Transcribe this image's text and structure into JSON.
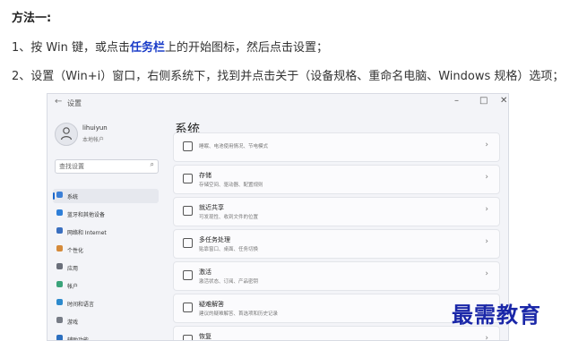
{
  "article": {
    "heading": "方法一:",
    "step1_pre": "1、按 Win 键，或点击",
    "step1_keyword": "任务栏",
    "step1_post": "上的开始图标，然后点击设置；",
    "step2": "2、设置（Win+i）窗口，右侧系统下，找到并点击关于（设备规格、重命名电脑、Windows 规格）选项；"
  },
  "window": {
    "back_glyph": "←",
    "title": "设置",
    "controls": {
      "minimize": "–",
      "maximize": "□",
      "close": "✕"
    },
    "user": {
      "name": "lihuiyun",
      "type": "本地帐户"
    },
    "search": {
      "placeholder": "查找设置",
      "icon": "search-icon"
    },
    "nav": [
      {
        "label": "系统",
        "color": "#3b7fd6",
        "active": true
      },
      {
        "label": "蓝牙和其他设备",
        "color": "#2f7fd8"
      },
      {
        "label": "网络和 Internet",
        "color": "#3a6fbf"
      },
      {
        "label": "个性化",
        "color": "#d58a3a"
      },
      {
        "label": "应用",
        "color": "#6a6f7a"
      },
      {
        "label": "帐户",
        "color": "#3aa37a"
      },
      {
        "label": "时间和语言",
        "color": "#2d8acd"
      },
      {
        "label": "游戏",
        "color": "#777c86"
      },
      {
        "label": "辅助功能",
        "color": "#2c6fbf"
      }
    ],
    "content": {
      "title": "系统",
      "cards": [
        {
          "title": "",
          "subtitle": "睡眠、电池使用情况、节电模式",
          "icon": "power-icon"
        },
        {
          "title": "存储",
          "subtitle": "存储空间、驱动器、配置规则",
          "icon": "storage-icon"
        },
        {
          "title": "就近共享",
          "subtitle": "可发现性、收到文件的位置",
          "icon": "share-icon"
        },
        {
          "title": "多任务处理",
          "subtitle": "贴靠窗口、桌面、任务切换",
          "icon": "multitask-icon"
        },
        {
          "title": "激活",
          "subtitle": "激活状态、订阅、产品密钥",
          "icon": "activation-icon"
        },
        {
          "title": "疑难解答",
          "subtitle": "建议的疑难解答、首选项和历史记录",
          "icon": "troubleshoot-icon"
        },
        {
          "title": "恢复",
          "subtitle": "",
          "icon": "recovery-icon"
        }
      ],
      "chevron": "›"
    }
  },
  "watermark": "最需教育"
}
